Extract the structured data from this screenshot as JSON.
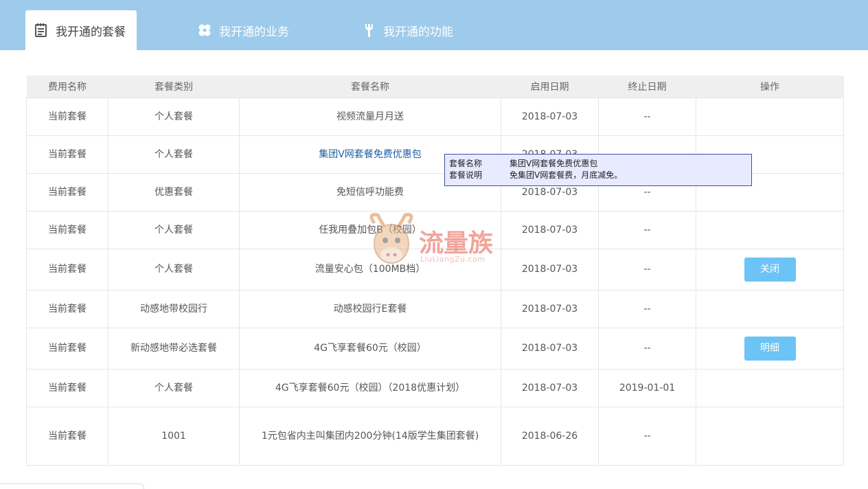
{
  "tabs": [
    {
      "label": "我开通的套餐",
      "icon": "notepad-icon",
      "active": true
    },
    {
      "label": "我开通的业务",
      "icon": "flower-icon",
      "active": false
    },
    {
      "label": "我开通的功能",
      "icon": "wrench-icon",
      "active": false
    }
  ],
  "table": {
    "headers": [
      "费用名称",
      "套餐类别",
      "套餐名称",
      "启用日期",
      "终止日期",
      "操作"
    ],
    "rows": [
      {
        "fee": "当前套餐",
        "category": "个人套餐",
        "name": "视频流量月月送",
        "start": "2018-07-03",
        "end": "--",
        "action": ""
      },
      {
        "fee": "当前套餐",
        "category": "个人套餐",
        "name": "集团V网套餐免费优惠包",
        "start": "2018-07-03",
        "end": "--",
        "action": ""
      },
      {
        "fee": "当前套餐",
        "category": "优惠套餐",
        "name": "免短信呼功能费",
        "start": "2018-07-03",
        "end": "--",
        "action": ""
      },
      {
        "fee": "当前套餐",
        "category": "个人套餐",
        "name": "任我用叠加包B（校园）",
        "start": "2018-07-03",
        "end": "--",
        "action": ""
      },
      {
        "fee": "当前套餐",
        "category": "个人套餐",
        "name": "流量安心包（100MB档）",
        "start": "2018-07-03",
        "end": "--",
        "action": "关闭"
      },
      {
        "fee": "当前套餐",
        "category": "动感地带校园行",
        "name": "动感校园行E套餐",
        "start": "2018-07-03",
        "end": "--",
        "action": ""
      },
      {
        "fee": "当前套餐",
        "category": "新动感地带必选套餐",
        "name": "4G飞享套餐60元（校园）",
        "start": "2018-07-03",
        "end": "--",
        "action": "明细"
      },
      {
        "fee": "当前套餐",
        "category": "个人套餐",
        "name": "4G飞享套餐60元（校园）（2018优惠计划）",
        "start": "2018-07-03",
        "end": "2019-01-01",
        "action": ""
      },
      {
        "fee": "当前套餐",
        "category": "1001",
        "name": "1元包省内主叫集团内200分钟(14版学生集团套餐)",
        "start": "2018-06-26",
        "end": "--",
        "action": ""
      }
    ]
  },
  "tooltip": {
    "name_label": "套餐名称",
    "name_value": "集团V网套餐免费优惠包",
    "desc_label": "套餐说明",
    "desc_value": "免集团V网套餐费，月底减免。"
  },
  "watermark": {
    "text": "流量族",
    "sub": "LiuLiangZu.com"
  },
  "colors": {
    "topbar": "#9ecbeb",
    "button": "#6cc3f6",
    "link": "#1a5f9e"
  }
}
